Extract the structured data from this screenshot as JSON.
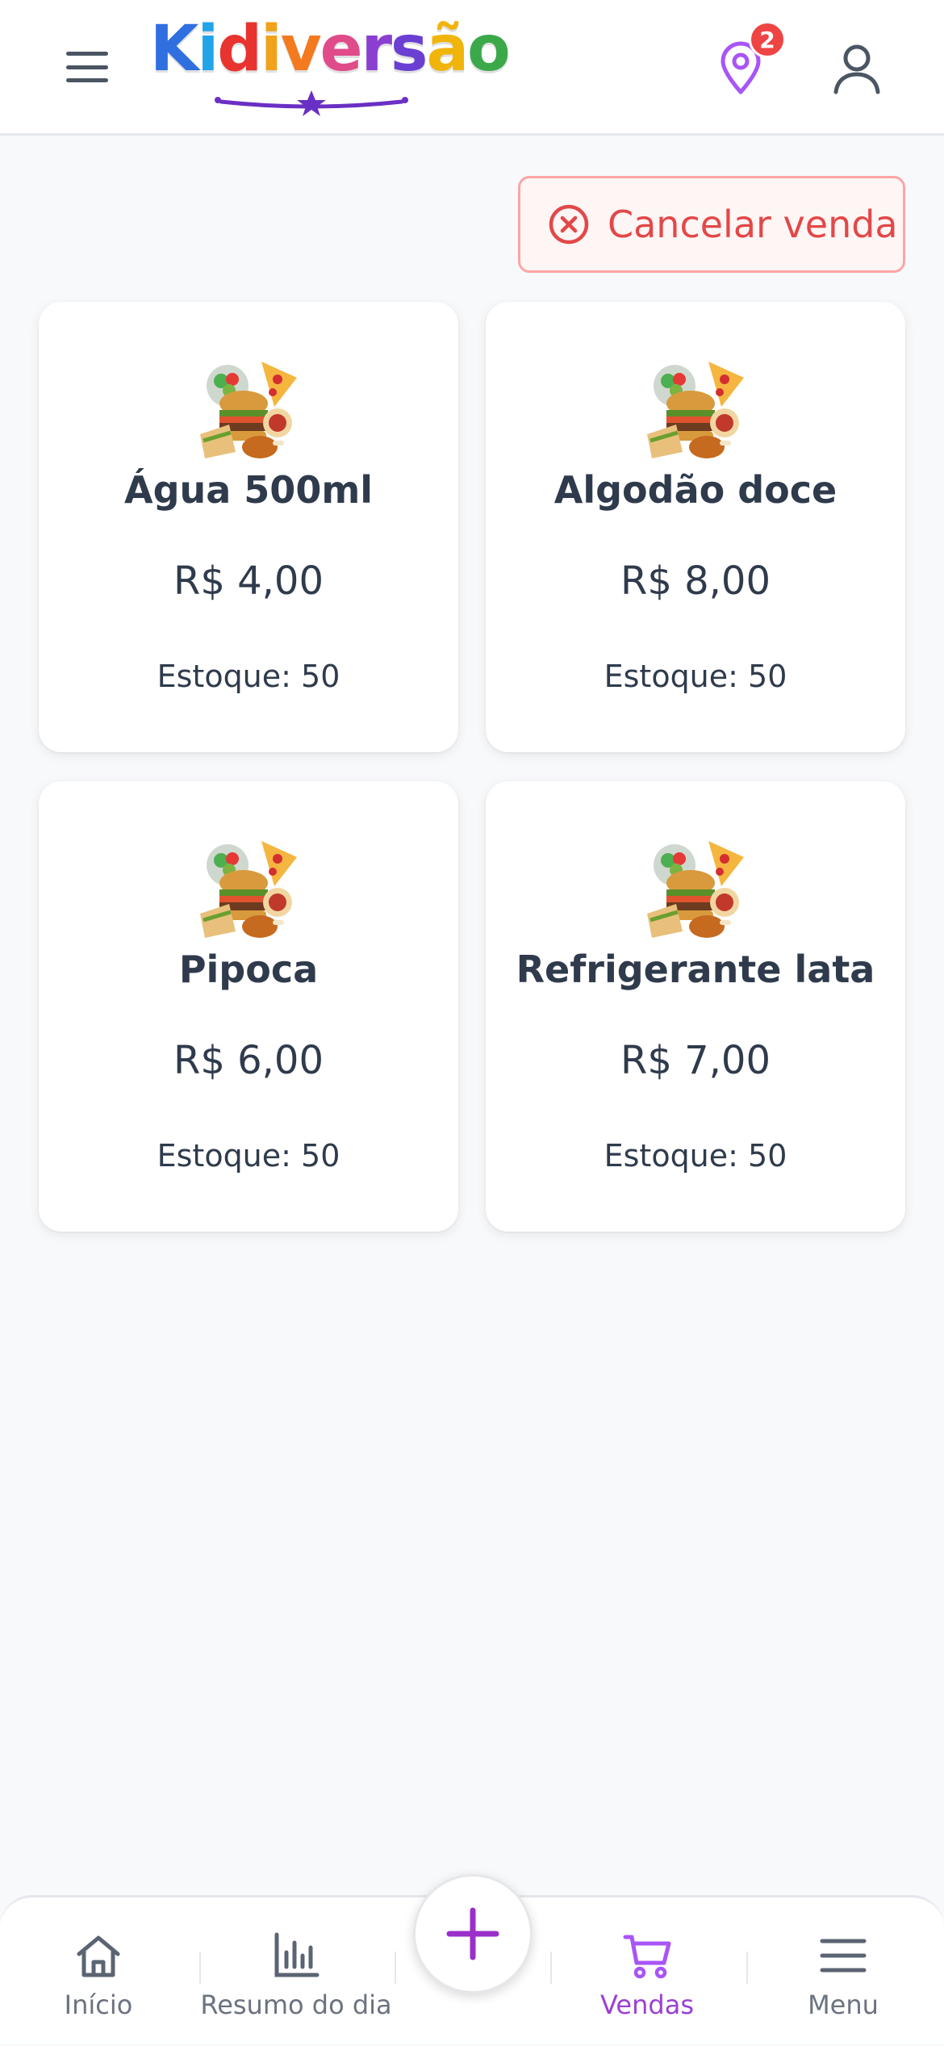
{
  "header": {
    "logo_text": "Kidiversão",
    "location_badge_count": "2",
    "icons": {
      "menu": "hamburger-menu-icon",
      "location": "map-pin-icon",
      "account": "user-icon"
    }
  },
  "actions": {
    "cancel_label": "Cancelar venda",
    "cancel_icon": "x-circle-icon"
  },
  "products": [
    {
      "name": "Água 500ml",
      "price": "R$ 4,00",
      "stock": "Estoque: 50",
      "icon": "food-collage-icon"
    },
    {
      "name": "Algodão doce",
      "price": "R$ 8,00",
      "stock": "Estoque: 50",
      "icon": "food-collage-icon"
    },
    {
      "name": "Pipoca",
      "price": "R$ 6,00",
      "stock": "Estoque: 50",
      "icon": "food-collage-icon"
    },
    {
      "name": "Refrigerante lata",
      "price": "R$ 7,00",
      "stock": "Estoque: 50",
      "icon": "food-collage-icon"
    }
  ],
  "bottom_nav": {
    "items": [
      {
        "label": "Início",
        "icon": "home-icon"
      },
      {
        "label": "Resumo do dia",
        "icon": "bar-chart-icon"
      },
      {
        "label": "Vendas",
        "icon": "shopping-cart-icon",
        "active": true
      },
      {
        "label": "Menu",
        "icon": "menu-icon"
      }
    ],
    "fab_icon": "plus-icon"
  },
  "colors": {
    "brand_purple": "#9b3fd6",
    "danger": "#e24848",
    "badge": "#ef4444",
    "text_dark": "#2f3b4c",
    "muted": "#6b7280",
    "background": "#f8f9fb"
  }
}
